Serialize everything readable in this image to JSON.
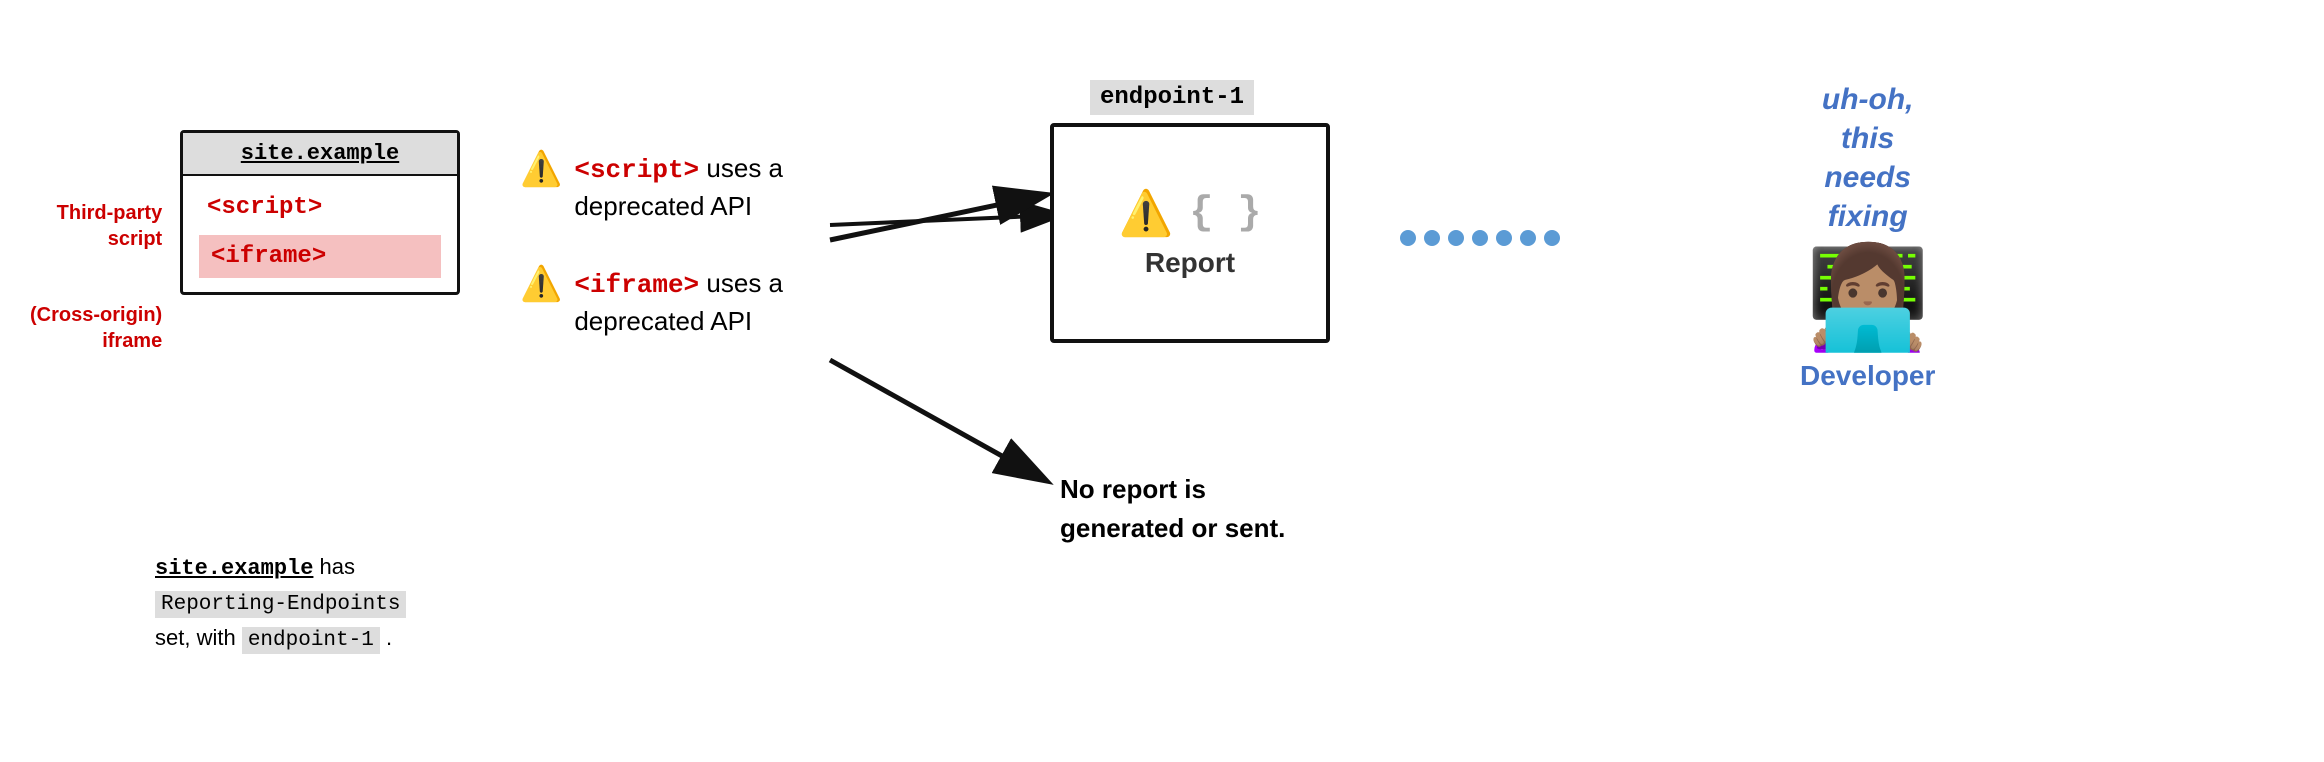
{
  "diagram": {
    "site_box": {
      "header": "site.example",
      "script_tag": "<script>",
      "iframe_tag": "<iframe>"
    },
    "left_labels": {
      "third_party": "Third-party\nscript",
      "cross_origin": "(Cross-origin)\niframe"
    },
    "bottom_text": {
      "part1": "site.example",
      "part2": " has",
      "line2_code": "Reporting-Endpoints",
      "line3": "set, with",
      "endpoint_code": "endpoint-1",
      "dot": "."
    },
    "warnings": [
      {
        "icon": "⚠️",
        "code": "<script>",
        "text": " uses a\ndeprecated API"
      },
      {
        "icon": "⚠️",
        "code": "<iframe>",
        "text": " uses a\ndeprecated API"
      }
    ],
    "endpoint": {
      "label": "endpoint-1",
      "report_label": "Report"
    },
    "no_report": "No report is\ngenerated or sent.",
    "developer": {
      "uh_oh": "uh-oh,\nthis\nneeds\nfixing",
      "label": "Developer"
    }
  }
}
